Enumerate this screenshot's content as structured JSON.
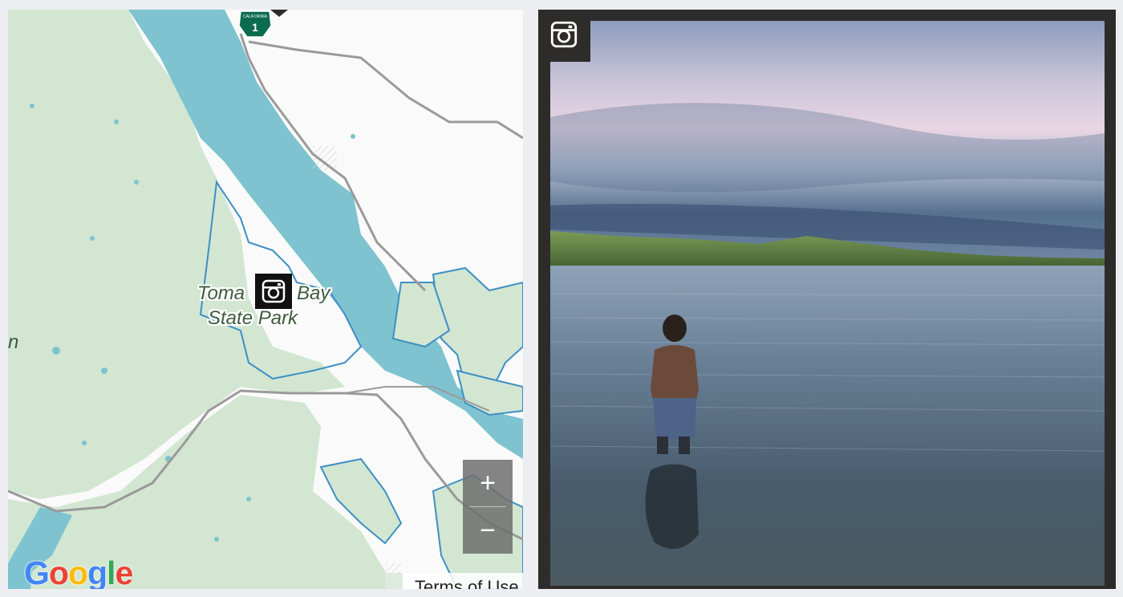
{
  "map": {
    "route_shield": {
      "label": "CALIFORNIA",
      "number": "1"
    },
    "park_label": {
      "part1": "Toma",
      "part2": "Bay",
      "line2": "State Park"
    },
    "edge_label": "n",
    "zoom": {
      "in_label": "+",
      "out_label": "−"
    },
    "google_logo": {
      "letters": [
        {
          "char": "G",
          "color": "#4285f4"
        },
        {
          "char": "o",
          "color": "#ea4335"
        },
        {
          "char": "o",
          "color": "#fbbc05"
        },
        {
          "char": "g",
          "color": "#4285f4"
        },
        {
          "char": "l",
          "color": "#34a853"
        },
        {
          "char": "e",
          "color": "#ea4335"
        }
      ]
    },
    "terms_label": "Terms of Use",
    "marker_icon": "instagram-icon",
    "colors": {
      "water": "#7ec3cf",
      "park": "#d2e6d2",
      "land": "#fafafa",
      "road": "#9a9a9a",
      "boundary": "#3d8fc4"
    }
  },
  "photo": {
    "badge_icon": "instagram-icon",
    "colors": {
      "frame": "#2e2c2a",
      "sky_top": "#8b9fc0",
      "sky_mid": "#e8d8e6",
      "water": "#4e6274"
    }
  }
}
